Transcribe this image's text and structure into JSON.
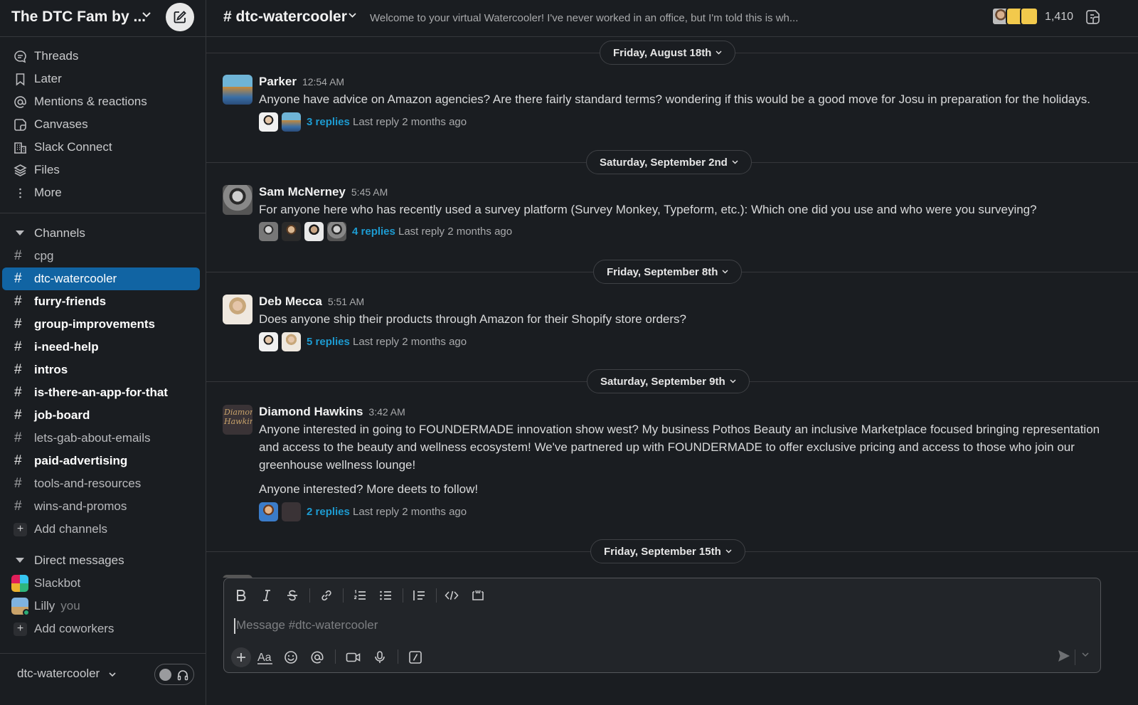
{
  "workspace": {
    "name": "The DTC Fam by ..."
  },
  "nav": [
    {
      "label": "Threads",
      "icon": "threads-icon"
    },
    {
      "label": "Later",
      "icon": "bookmark-icon"
    },
    {
      "label": "Mentions & reactions",
      "icon": "at-icon"
    },
    {
      "label": "Canvases",
      "icon": "canvas-icon"
    },
    {
      "label": "Slack Connect",
      "icon": "building-icon"
    },
    {
      "label": "Files",
      "icon": "layers-icon"
    },
    {
      "label": "More",
      "icon": "more-vertical-icon"
    }
  ],
  "channels": {
    "header": "Channels",
    "items": [
      {
        "name": "cpg",
        "unread": false,
        "active": false
      },
      {
        "name": "dtc-watercooler",
        "unread": false,
        "active": true
      },
      {
        "name": "furry-friends",
        "unread": true,
        "active": false
      },
      {
        "name": "group-improvements",
        "unread": true,
        "active": false
      },
      {
        "name": "i-need-help",
        "unread": true,
        "active": false
      },
      {
        "name": "intros",
        "unread": true,
        "active": false
      },
      {
        "name": "is-there-an-app-for-that",
        "unread": true,
        "active": false
      },
      {
        "name": "job-board",
        "unread": true,
        "active": false
      },
      {
        "name": "lets-gab-about-emails",
        "unread": false,
        "active": false
      },
      {
        "name": "paid-advertising",
        "unread": true,
        "active": false
      },
      {
        "name": "tools-and-resources",
        "unread": false,
        "active": false
      },
      {
        "name": "wins-and-promos",
        "unread": false,
        "active": false
      }
    ],
    "add_label": "Add channels"
  },
  "direct_messages": {
    "header": "Direct messages",
    "items": [
      {
        "name": "Slackbot",
        "suffix": ""
      },
      {
        "name": "Lilly",
        "suffix": "you"
      }
    ],
    "add_label": "Add coworkers"
  },
  "footer": {
    "channel": "dtc-watercooler"
  },
  "channel": {
    "title": "# dtc-watercooler",
    "topic": "Welcome to your virtual Watercooler! I've never worked in an office, but I'm told this is wh...",
    "member_count": "1,410"
  },
  "dates": [
    "Friday, August 18th",
    "Saturday, September 2nd",
    "Friday, September 8th",
    "Saturday, September 9th",
    "Friday, September 15th"
  ],
  "messages": [
    {
      "author": "Parker",
      "time": "12:54 AM",
      "text": "Anyone have advice on Amazon agencies?  Are there fairly standard terms?  wondering if this would be a good move for Josu in preparation for the holidays.",
      "replies": "3 replies",
      "last_reply": "Last reply 2 months ago"
    },
    {
      "author": "Sam McNerney",
      "time": "5:45 AM",
      "text": "For anyone here who has recently used a survey platform (Survey Monkey, Typeform, etc.): Which one did you use and who were you surveying?",
      "replies": "4 replies",
      "last_reply": "Last reply 2 months ago"
    },
    {
      "author": "Deb Mecca",
      "time": "5:51 AM",
      "text": "Does anyone ship their products through Amazon for their Shopify store orders?",
      "replies": "5 replies",
      "last_reply": "Last reply 2 months ago"
    },
    {
      "author": "Diamond Hawkins",
      "time": "3:42 AM",
      "text": "Anyone interested in going to FOUNDERMADE innovation show west? My business Pothos Beauty an inclusive Marketplace focused bringing representation and access to the beauty and wellness ecosystem!  We've partnered up with FOUNDERMADE to offer exclusive pricing and access to those who join our greenhouse wellness lounge!",
      "text2": "Anyone interested? More deets to follow!",
      "replies": "2 replies",
      "last_reply": "Last reply 2 months ago",
      "avatar_text": "Diamond Hawkins"
    }
  ],
  "composer": {
    "placeholder": "Message #dtc-watercooler"
  },
  "colors": {
    "background": "#1a1d21",
    "active_channel": "#1164a3",
    "link": "#1d9bd1",
    "online": "#2bac76"
  }
}
